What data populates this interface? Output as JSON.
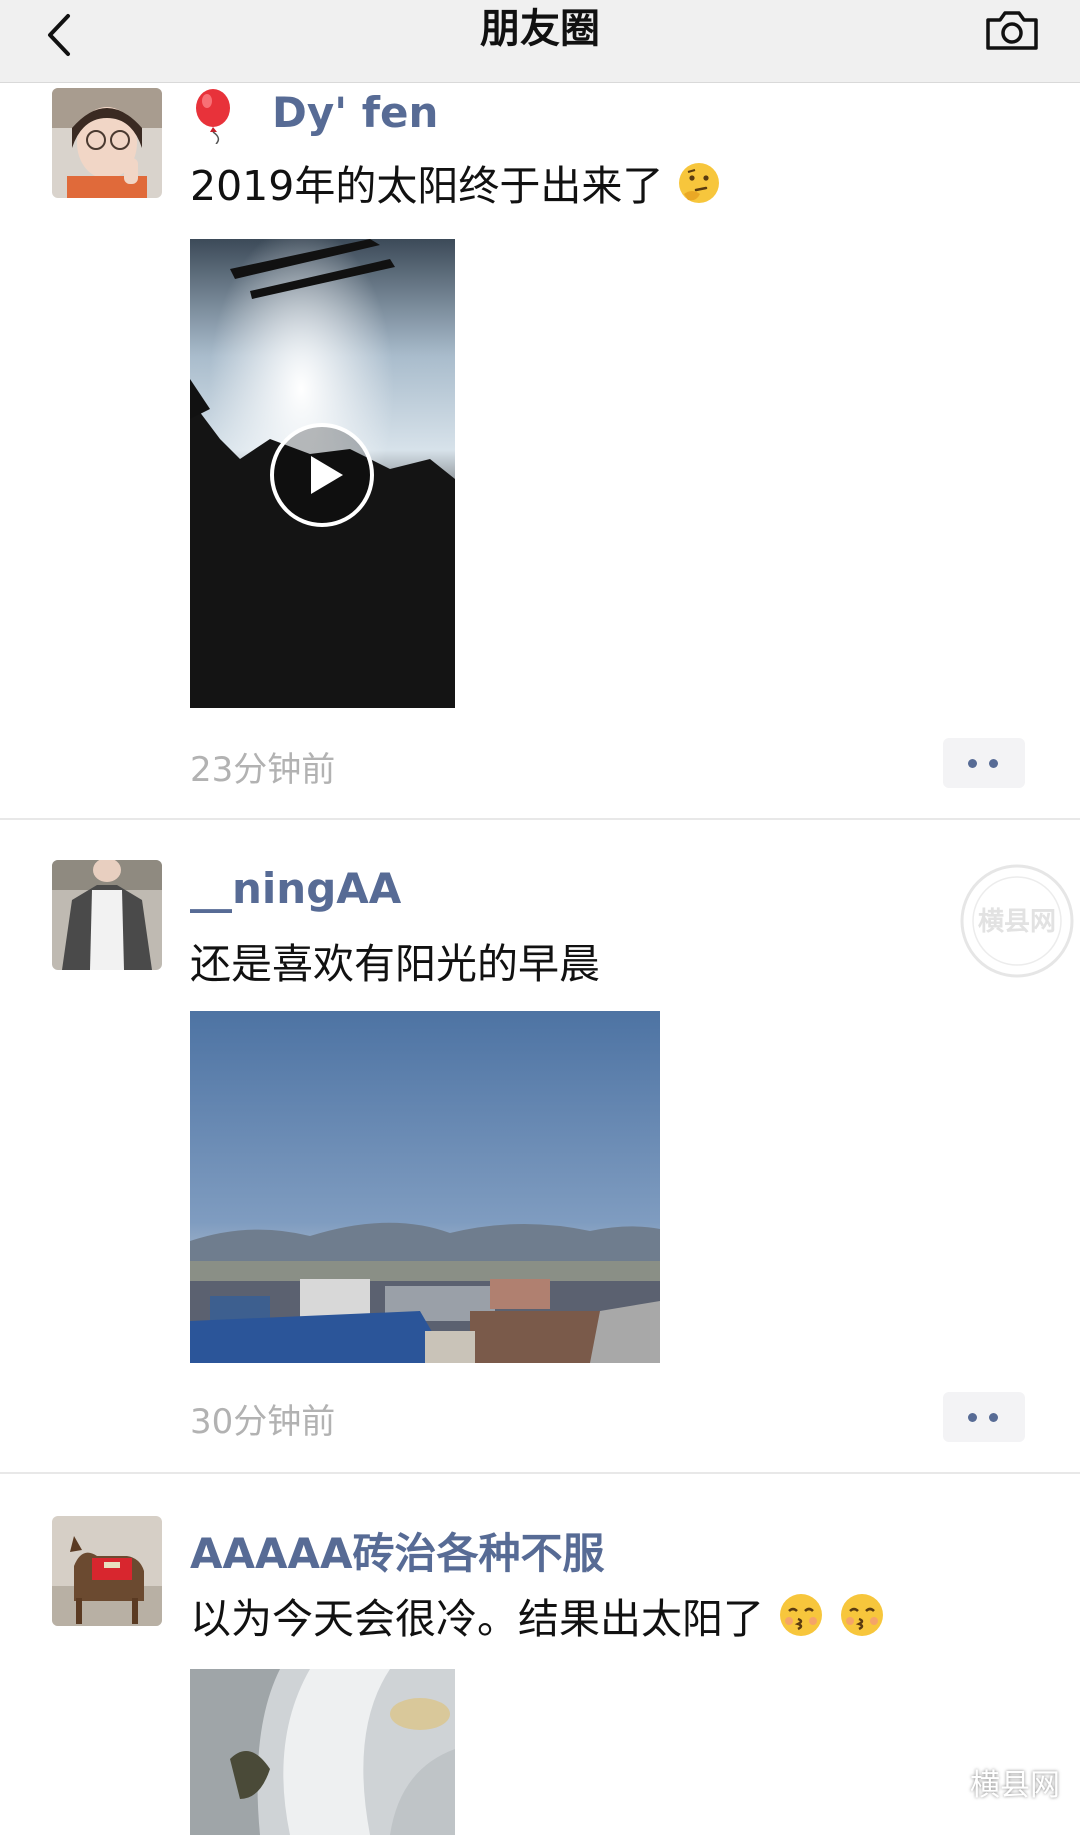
{
  "nav": {
    "title": "朋友圈",
    "back_icon": "chevron-left-icon",
    "camera_icon": "camera-icon"
  },
  "posts": [
    {
      "name": "Dy' fen",
      "name_prefix_icon": "balloon-icon",
      "text": "2019年的太阳终于出来了",
      "text_emojis": [
        "thinking-face-icon"
      ],
      "media_type": "video",
      "time": "23分钟前"
    },
    {
      "name": "__ningAA",
      "text": "还是喜欢有阳光的早晨",
      "text_emojis": [],
      "media_type": "photo",
      "time": "30分钟前"
    },
    {
      "name": "AAAAA砖治各种不服",
      "text": "以为今天会很冷。结果出太阳了",
      "text_emojis": [
        "kissing-face-icon",
        "kissing-face-icon"
      ],
      "media_type": "photo"
    }
  ],
  "watermark": {
    "label": "横县网",
    "stamp_text": "横县网"
  },
  "colors": {
    "nickname": "#576b95",
    "timestamp": "#b2b2b2",
    "nav_bg": "#f0f0f0"
  }
}
